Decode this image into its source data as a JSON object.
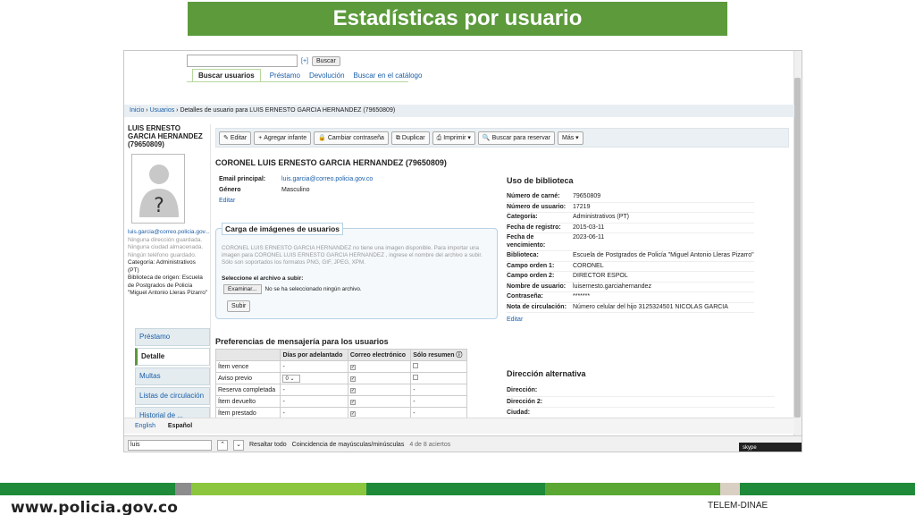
{
  "slide_title": "Estadísticas por usuario",
  "search": {
    "value": "",
    "advanced_label": "[+]",
    "button_label": "Buscar"
  },
  "search_tabs": [
    "Buscar usuarios",
    "Préstamo",
    "Devolución",
    "Buscar en el catálogo"
  ],
  "breadcrumb": {
    "home": "Inicio",
    "sep": "›",
    "patrons": "Usuarios",
    "current": "Detalles de usuario para LUIS ERNESTO GARCIA HERNANDEZ (79650809)"
  },
  "left": {
    "name": "LUIS ERNESTO GARCIA HERNANDEZ (79650809)",
    "email": "luis.garcia@correo.policia.gov...",
    "no_address": "Ninguna dirección guardada.",
    "no_city": "Ninguna ciudad almacenada.",
    "no_phone": "Ningún teléfono guardado.",
    "category": "Categoría: Administrativos (PT)",
    "library": "Biblioteca de origen: Escuela de Postgrados de Policía \"Miguel Antonio Lleras Pizarro\""
  },
  "left_nav": [
    "Préstamo",
    "Detalle",
    "Multas",
    "Listas de circulación",
    "Historial de ..."
  ],
  "toolbar": [
    {
      "icon": "✎",
      "label": "Editar"
    },
    {
      "icon": "+",
      "label": "Agregar infante"
    },
    {
      "icon": "🔒",
      "label": "Cambiar contraseña"
    },
    {
      "icon": "⧉",
      "label": "Duplicar"
    },
    {
      "icon": "⎙",
      "label": "Imprimir ▾"
    },
    {
      "icon": "🔍",
      "label": "Buscar para reservar"
    },
    {
      "icon": "",
      "label": "Más ▾"
    }
  ],
  "patron": {
    "heading": "CORONEL LUIS ERNESTO GARCIA HERNANDEZ (79650809)",
    "email_label": "Email principal:",
    "email_value": "luis.garcia@correo.policia.gov.co",
    "gender_label": "Género",
    "gender_value": "Masculino",
    "edit": "Editar"
  },
  "upload": {
    "legend": "Carga de imágenes de usuarios",
    "text": "CORONEL LUIS ERNESTO GARCIA HERNANDEZ no tiene una imagen disponible. Para importar una imagen para CORONEL LUIS ERNESTO GARCIA HERNANDEZ , ingrese el nombre del archivo a subir. Sólo son soportados los formatos PNG, GIF, JPEG, XPM.",
    "select_label": "Seleccione el archivo a subir:",
    "browse": "Examinar...",
    "no_file": "No se ha seleccionado ningún archivo.",
    "submit": "Subir"
  },
  "messaging": {
    "title": "Preferencias de mensajería para los usuarios",
    "headers": [
      "",
      "Días por adelantado",
      "Correo electrónico",
      "Sólo resumen ⓘ"
    ],
    "rows": [
      {
        "label": "Ítem vence",
        "days": "-",
        "email": true,
        "digest": false
      },
      {
        "label": "Aviso previo",
        "days": "0",
        "email": true,
        "digest": false
      },
      {
        "label": "Reserva completada",
        "days": "-",
        "email": true,
        "digest": "-"
      },
      {
        "label": "Ítem devuelto",
        "days": "-",
        "email": true,
        "digest": "-"
      },
      {
        "label": "Ítem prestado",
        "days": "-",
        "email": true,
        "digest": "-"
      }
    ]
  },
  "library_use": {
    "title": "Uso de biblioteca",
    "rows": [
      {
        "label": "Número de carné:",
        "value": "79650809"
      },
      {
        "label": "Número de usuario:",
        "value": "17219"
      },
      {
        "label": "Categoría:",
        "value": "Administrativos (PT)"
      },
      {
        "label": "Fecha de registro:",
        "value": "2015-03-11"
      },
      {
        "label": "Fecha de vencimiento:",
        "value": "2023-06-11"
      },
      {
        "label": "Biblioteca:",
        "value": "Escuela de Postgrados de Policía \"Miguel Antonio Lleras Pizarro\""
      },
      {
        "label": "Campo orden 1:",
        "value": "CORONEL"
      },
      {
        "label": "Campo orden 2:",
        "value": "DIRECTOR ESPOL"
      },
      {
        "label": "Nombre de usuario:",
        "value": "luisernesto.garciahernandez"
      },
      {
        "label": "Contraseña:",
        "value": "*******"
      },
      {
        "label": "Nota de circulación:",
        "value": "Número celular del hijo 3125324501 NICOLAS GARCIA"
      }
    ],
    "edit": "Editar"
  },
  "alt_address": {
    "title": "Dirección alternativa",
    "rows": [
      "Dirección:",
      "Dirección 2:",
      "Ciudad:"
    ]
  },
  "languages": [
    "English",
    "Español"
  ],
  "find_bar": {
    "value": "luis",
    "highlight_all": "Resaltar todo",
    "match_case": "Coincidencia de mayúsculas/minúsculas",
    "status": "4 de 8 aciertos"
  },
  "skype_badge": "skype",
  "footer": {
    "url": "www.policia.gov.co",
    "tag": "TELEM-DINAE"
  },
  "colors": {
    "brand_green": "#5c9a3c",
    "link_blue": "#1a5ea8"
  }
}
